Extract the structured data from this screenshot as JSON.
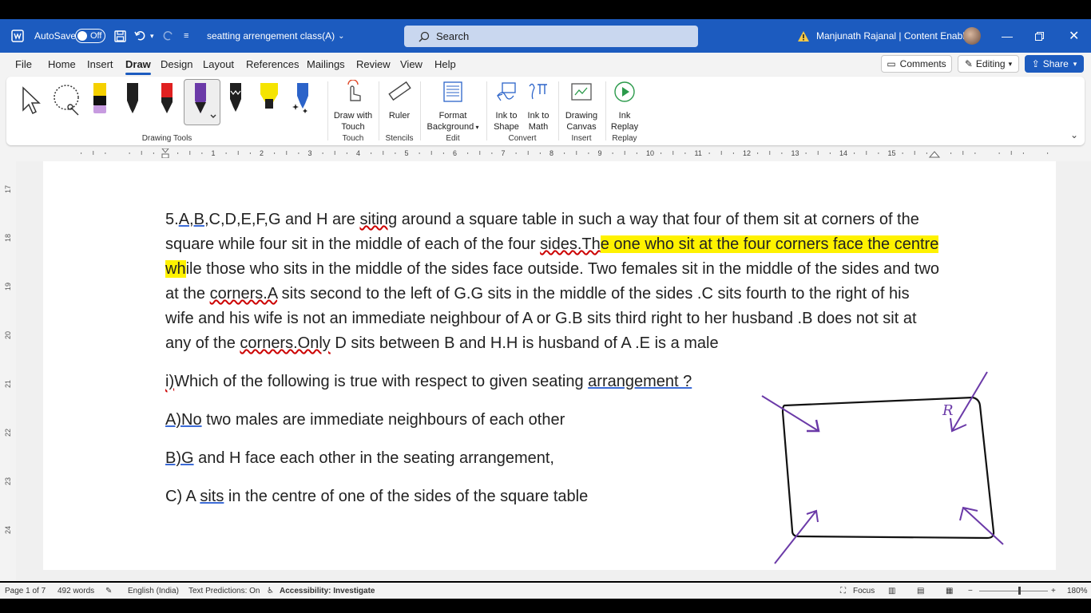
{
  "titlebar": {
    "autosave_label": "AutoSave",
    "autosave_state": "Off",
    "doc_title": "seatting arrengement class(A)",
    "search_placeholder": "Search",
    "user_name": "Manjunath Rajanal | Content Enablers"
  },
  "menu": {
    "tabs": [
      "File",
      "Home",
      "Insert",
      "Draw",
      "Design",
      "Layout",
      "References",
      "Mailings",
      "Review",
      "View",
      "Help"
    ],
    "active_tab": "Draw",
    "comments_label": "Comments",
    "editing_label": "Editing",
    "share_label": "Share"
  },
  "ribbon": {
    "groups": {
      "drawing_tools": "Drawing Tools",
      "touch": "Touch",
      "stencils": "Stencils",
      "edit": "Edit",
      "convert": "Convert",
      "insert": "Insert",
      "replay": "Replay"
    },
    "buttons": {
      "draw_with_touch": [
        "Draw with",
        "Touch"
      ],
      "ruler": "Ruler",
      "format_background": [
        "Format",
        "Background"
      ],
      "ink_to_shape": [
        "Ink to",
        "Shape"
      ],
      "ink_to_math": [
        "Ink to",
        "Math"
      ],
      "drawing_canvas": [
        "Drawing",
        "Canvas"
      ],
      "ink_replay": [
        "Ink",
        "Replay"
      ]
    },
    "pen_colors": [
      "#1f1f1f",
      "#1f1f1f",
      "#e02020",
      "#6b3aa8",
      "#1f1f1f",
      "#f5e400",
      "#2b63c9"
    ]
  },
  "ruler": {
    "h_marks": [
      "1",
      "2",
      "3",
      "4",
      "5",
      "6",
      "7",
      "8",
      "9",
      "10",
      "11",
      "12",
      "13",
      "14",
      "15"
    ],
    "v_marks": [
      "17",
      "18",
      "19",
      "20",
      "21",
      "22",
      "23",
      "24"
    ]
  },
  "document": {
    "p1": {
      "a": "5.",
      "b": "A,B",
      "c": ",C,D,E,F,G and H are ",
      "d": "siting",
      "e": " around a square table in such a way that four of them sit at corners of the square while four sit in the middle of each of the four ",
      "f": "sides.Th",
      "g": "e one who sit at the four corners face the centre wh",
      "h": "ile those who sits in the middle of the sides face outside. Two females sit in the middle of the sides and two at the ",
      "i": "corners.A",
      "j": " sits second to the left of G.G sits in the middle of the sides .C sits fourth to the right of his wife and his wife is not an immediate neighbour of A or G.B sits third right to her husband .B does not sit at any of the ",
      "k": "corners.Only",
      "l": " D sits between B and H.H is husband of A .E is a male"
    },
    "q1": {
      "a": "i)",
      "b": "Which of the following is true with respect to given seating ",
      "c": "arrangement ?"
    },
    "optA": {
      "a": "A)No",
      "b": " two males are immediate neighbours of each other"
    },
    "optB": {
      "a": "B)G",
      "b": " and H face each other in the seating arrangement,"
    },
    "optC": {
      "a": "C) A ",
      "b": "sits",
      "c": " in the centre of one of the sides of the square table"
    }
  },
  "ink_label": "R",
  "status": {
    "page": "Page 1 of 7",
    "words": "492 words",
    "language": "English (India)",
    "predictions": "Text Predictions: On",
    "accessibility": "Accessibility: Investigate",
    "focus": "Focus",
    "zoom": "180%"
  }
}
